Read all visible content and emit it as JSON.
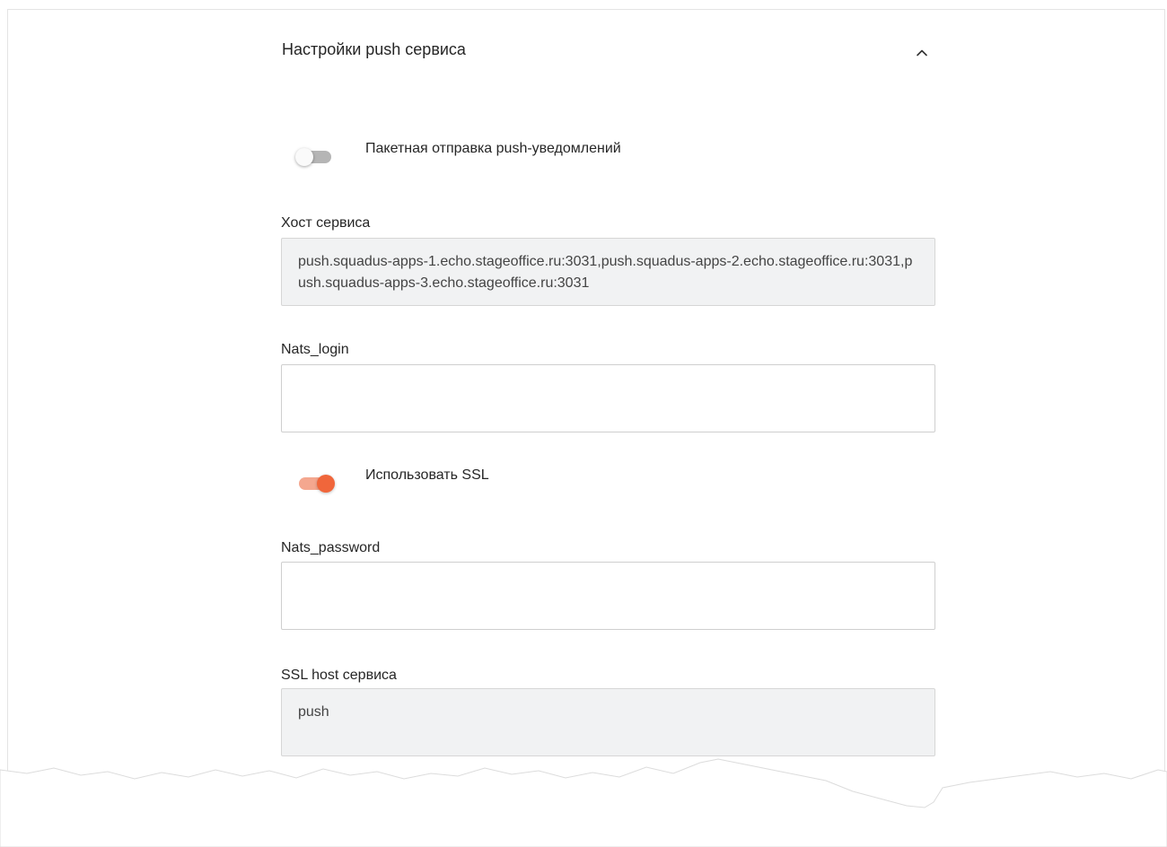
{
  "section": {
    "title": "Настройки push сервиса"
  },
  "icons": {
    "collapse": "chevron-up-icon"
  },
  "batch_toggle": {
    "label": "Пакетная отправка push-уведомлений",
    "enabled": false
  },
  "ssl_toggle": {
    "label": "Использовать SSL",
    "enabled": true
  },
  "service_host": {
    "label": "Хост сервиса",
    "value": "push.squadus-apps-1.echo.stageoffice.ru:3031,push.squadus-apps-2.echo.stageoffice.ru:3031,push.squadus-apps-3.echo.stageoffice.ru:3031"
  },
  "nats_login": {
    "label": "Nats_login",
    "value": ""
  },
  "nats_password": {
    "label": "Nats_password",
    "value": ""
  },
  "ssl_host": {
    "label": "SSL host сервиса",
    "value": "push"
  },
  "colors": {
    "accent": "#f0663b",
    "accent_track": "#f4a78f",
    "readonly_bg": "#f1f2f3"
  }
}
